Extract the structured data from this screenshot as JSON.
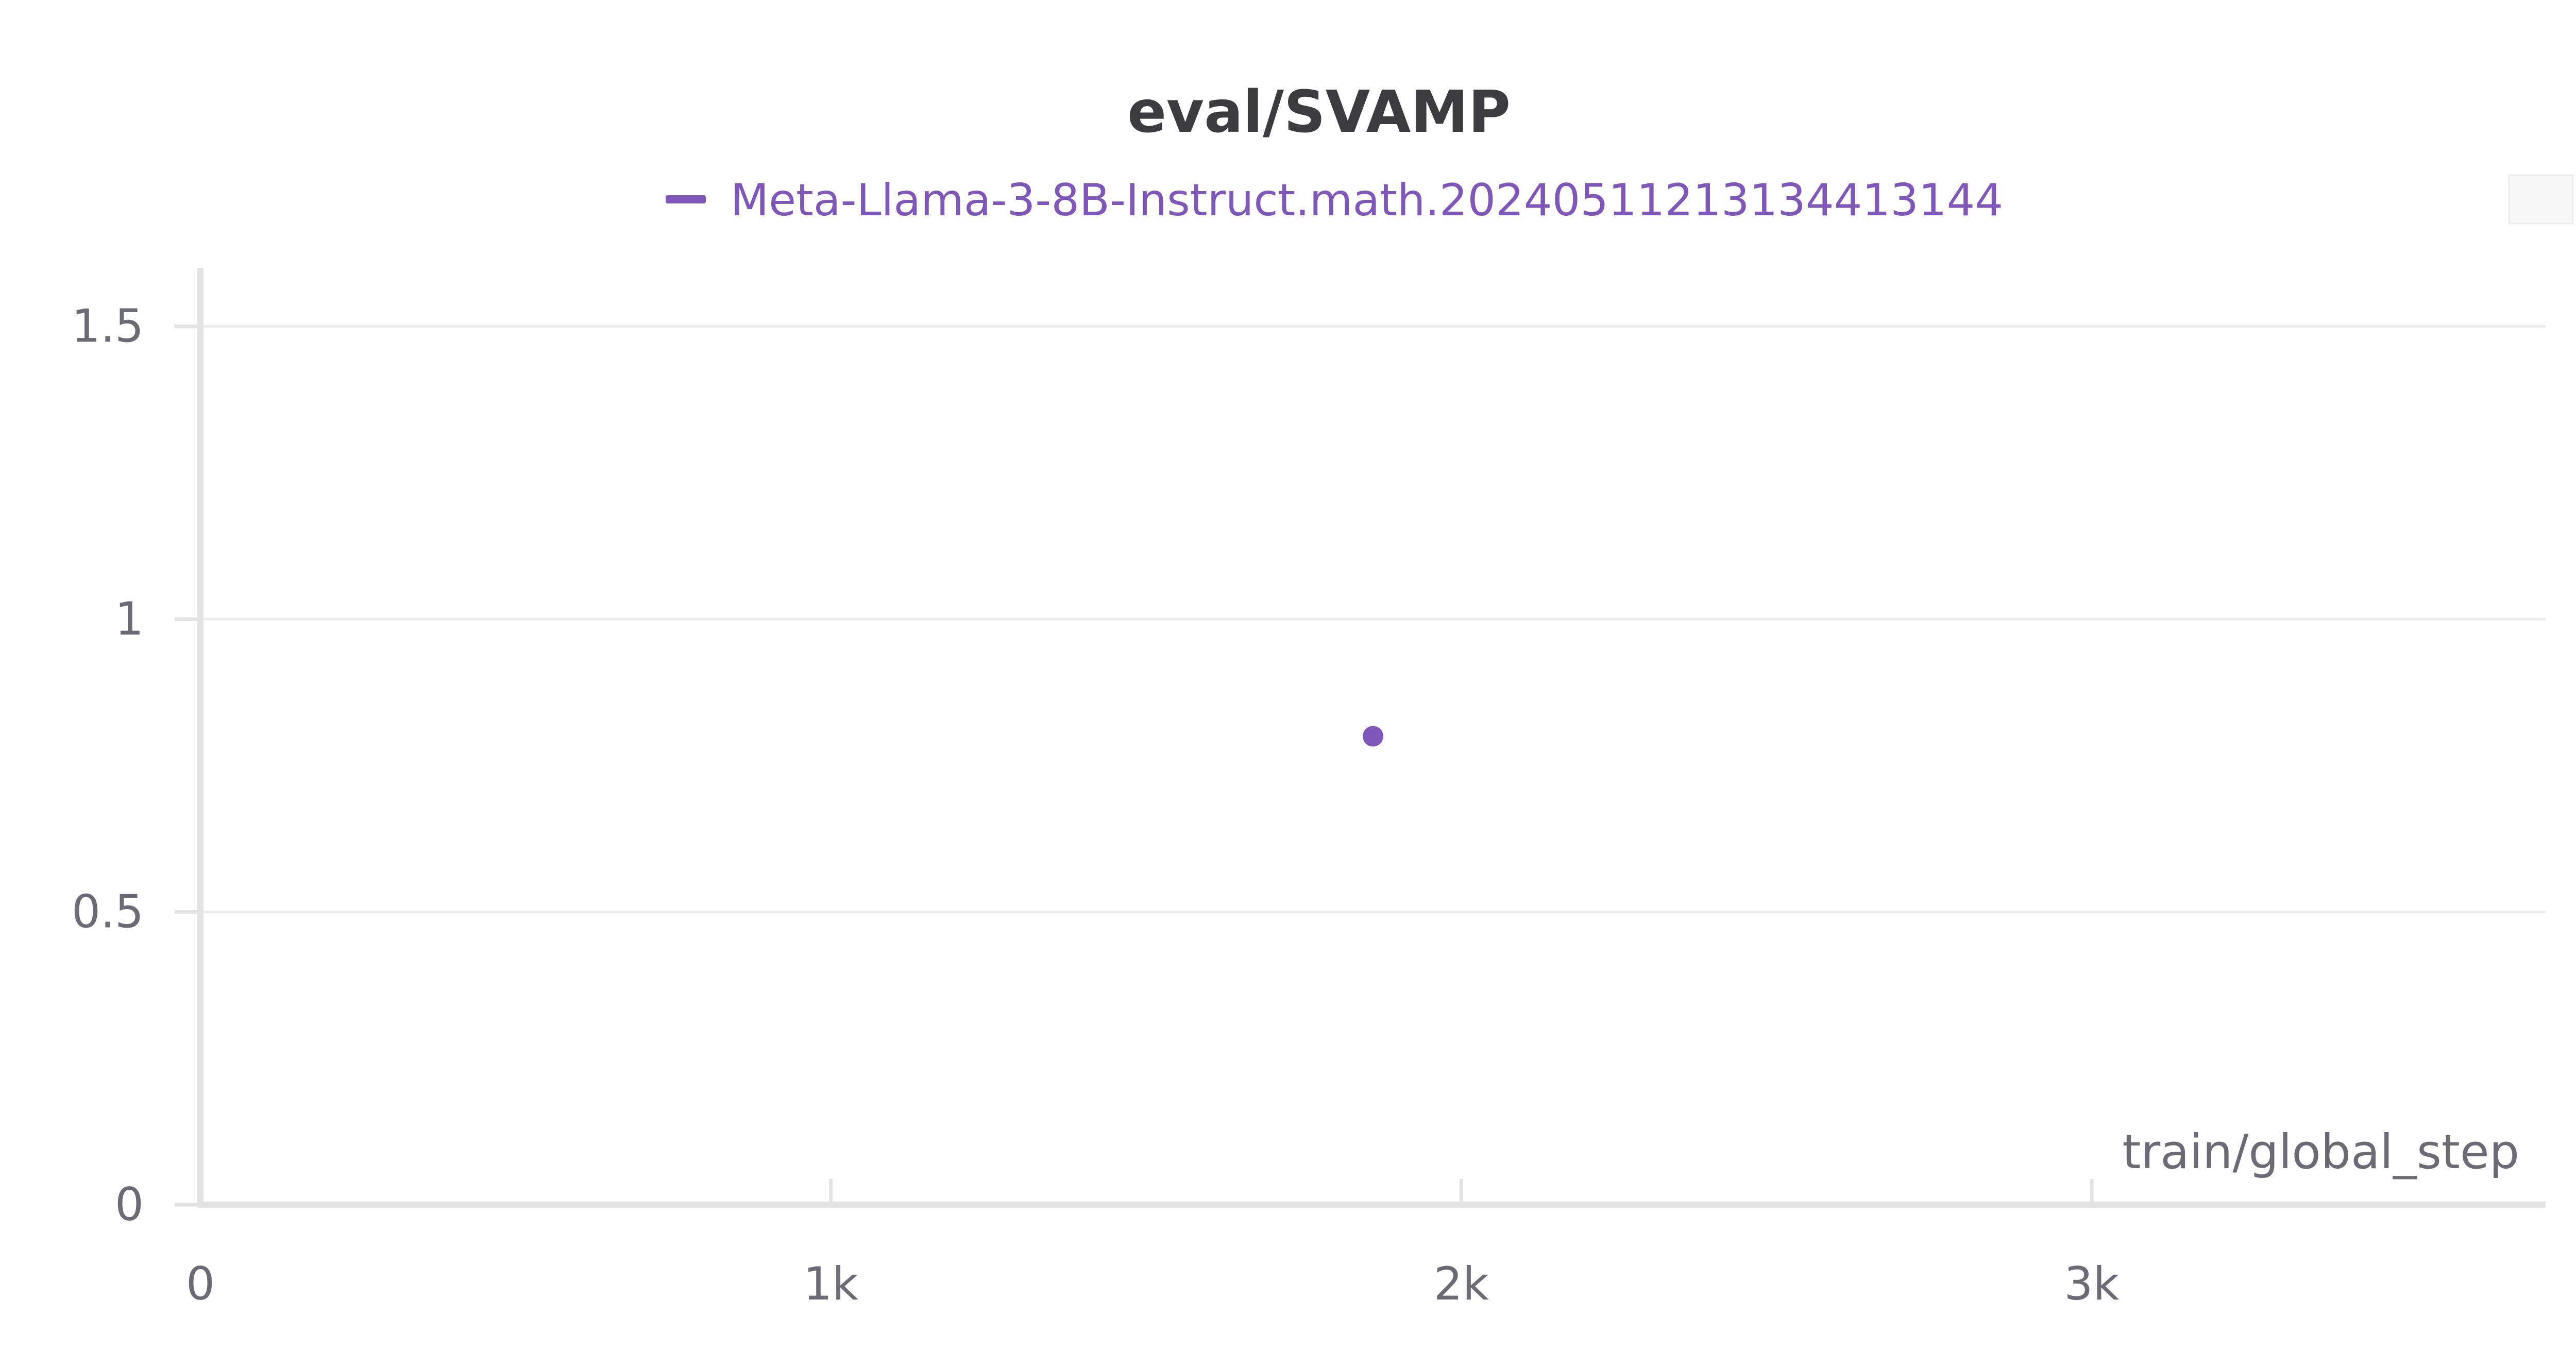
{
  "colors": {
    "series": "#7e57b8",
    "grid": "#ececec",
    "axis": "#e3e3e3",
    "text": "#6b6b76",
    "title": "#3b3b40"
  },
  "chart_data": {
    "type": "scatter",
    "title": "eval/SVAMP",
    "xlabel": "train/global_step",
    "ylabel": "",
    "xlim": [
      0,
      3720
    ],
    "ylim": [
      0,
      1.6
    ],
    "x_ticks": [
      {
        "value": 0,
        "label": "0"
      },
      {
        "value": 1000,
        "label": "1k"
      },
      {
        "value": 2000,
        "label": "2k"
      },
      {
        "value": 3000,
        "label": "3k"
      }
    ],
    "y_ticks": [
      {
        "value": 0,
        "label": "0"
      },
      {
        "value": 0.5,
        "label": "0.5"
      },
      {
        "value": 1,
        "label": "1"
      },
      {
        "value": 1.5,
        "label": "1.5"
      }
    ],
    "grid": true,
    "legend_position": "top-center",
    "series": [
      {
        "name": "Meta-Llama-3-8B-Instruct.math.20240511213134413144",
        "color": "#7e57b8",
        "points": [
          {
            "x": 1860,
            "y": 0.8
          }
        ]
      }
    ]
  }
}
